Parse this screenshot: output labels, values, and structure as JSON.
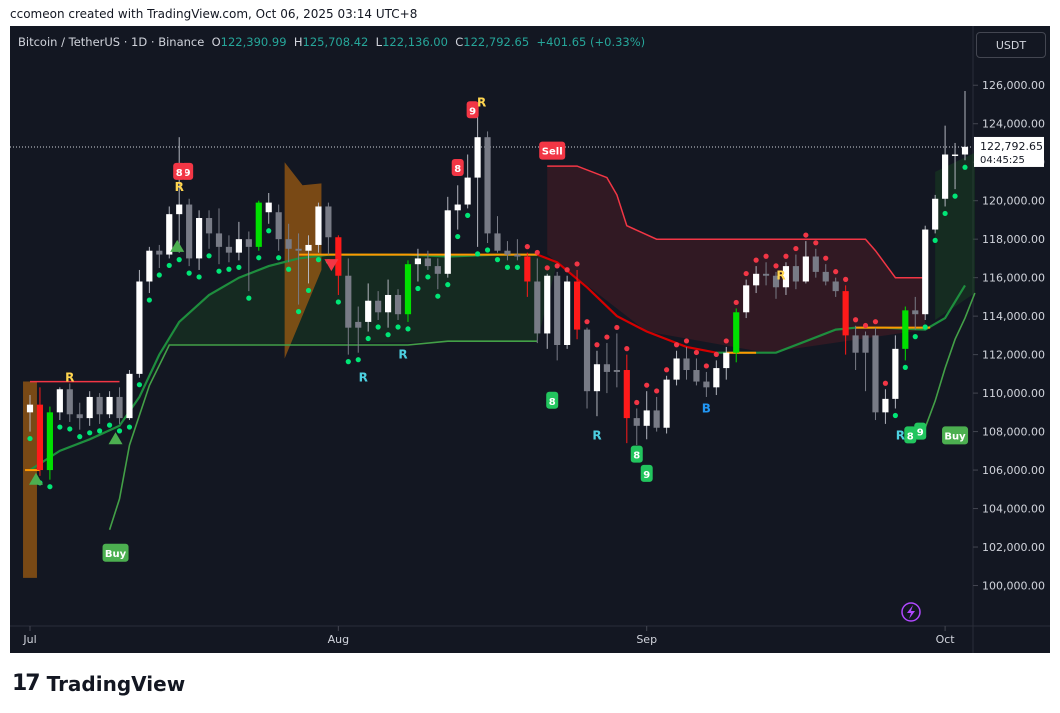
{
  "caption": "ccomeon created with TradingView.com, Oct 06, 2025 03:14 UTC+8",
  "legend": {
    "symbol": "Bitcoin / TetherUS · 1D · Binance",
    "open_key": "O",
    "open_val": "122,390.99",
    "high_key": "H",
    "high_val": "125,708.42",
    "low_key": "L",
    "low_val": "122,136.00",
    "close_key": "C",
    "close_val": "122,792.65",
    "change": "+401.65 (+0.33%)"
  },
  "currency_button": "USDT",
  "price_label": {
    "price": "122,792.65",
    "countdown": "04:45:25"
  },
  "footer": {
    "logo_mark": "17",
    "brand": "TradingView"
  },
  "colors": {
    "up": "#ffffff",
    "down": "#f23645",
    "bull": "#00c853",
    "bear": "#ff0000",
    "neutral": "#787b86",
    "bg": "#131722"
  },
  "chart_data": {
    "type": "candlestick",
    "y_range": [
      98000,
      127000
    ],
    "y_ticks": [
      100000,
      102000,
      104000,
      106000,
      108000,
      110000,
      112000,
      114000,
      116000,
      118000,
      120000,
      122000,
      124000,
      126000
    ],
    "y_tick_labels": [
      "100,000.00",
      "102,000.00",
      "104,000.00",
      "106,000.00",
      "108,000.00",
      "110,000.00",
      "112,000.00",
      "114,000.00",
      "116,000.00",
      "118,000.00",
      "120,000.00",
      "122,000.00",
      "124,000.00",
      "126,000.00"
    ],
    "x_labels": [
      {
        "label": "Jul",
        "idx": 0
      },
      {
        "label": "Aug",
        "idx": 31
      },
      {
        "label": "Sep",
        "idx": 62
      },
      {
        "label": "Oct",
        "idx": 92
      }
    ],
    "close_price": 122792.65,
    "candles": [
      [
        109000,
        109900,
        108000,
        109400,
        "w"
      ],
      [
        109400,
        110300,
        105700,
        106000,
        "r"
      ],
      [
        106000,
        109300,
        105500,
        109000,
        "g"
      ],
      [
        109000,
        110300,
        108600,
        110200,
        "w"
      ],
      [
        110200,
        110500,
        108500,
        108900,
        "n"
      ],
      [
        108900,
        109500,
        108100,
        108700,
        "n"
      ],
      [
        108700,
        110100,
        108300,
        109800,
        "w"
      ],
      [
        109800,
        110000,
        108400,
        108900,
        "n"
      ],
      [
        108900,
        110100,
        108700,
        109800,
        "w"
      ],
      [
        109800,
        110300,
        108400,
        108700,
        "n"
      ],
      [
        108700,
        111200,
        108600,
        111000,
        "w"
      ],
      [
        111000,
        116400,
        110800,
        115800,
        "w"
      ],
      [
        115800,
        117600,
        115200,
        117400,
        "w"
      ],
      [
        117400,
        117700,
        116500,
        117200,
        "n"
      ],
      [
        117200,
        119700,
        117000,
        119300,
        "w"
      ],
      [
        119300,
        123300,
        117300,
        119800,
        "w"
      ],
      [
        119800,
        120100,
        116600,
        117000,
        "n"
      ],
      [
        117000,
        119500,
        116400,
        119100,
        "w"
      ],
      [
        119100,
        119500,
        117500,
        118300,
        "n"
      ],
      [
        118300,
        119600,
        116700,
        117600,
        "n"
      ],
      [
        117600,
        118200,
        116800,
        117300,
        "n"
      ],
      [
        117300,
        118900,
        116900,
        118000,
        "w"
      ],
      [
        118000,
        118400,
        115300,
        117600,
        "n"
      ],
      [
        117600,
        120000,
        117400,
        119900,
        "g"
      ],
      [
        119900,
        120400,
        118800,
        119400,
        "w"
      ],
      [
        119400,
        119800,
        117400,
        118000,
        "n"
      ],
      [
        118000,
        118800,
        116800,
        117500,
        "n"
      ],
      [
        117500,
        118300,
        114600,
        117400,
        "n"
      ],
      [
        117400,
        118200,
        115700,
        117700,
        "w"
      ],
      [
        117700,
        119900,
        117300,
        119700,
        "w"
      ],
      [
        119700,
        119900,
        117200,
        118100,
        "n"
      ],
      [
        118100,
        118200,
        115100,
        116100,
        "r"
      ],
      [
        116100,
        117000,
        112000,
        113400,
        "n"
      ],
      [
        113400,
        114500,
        112100,
        113700,
        "n"
      ],
      [
        113700,
        115700,
        113200,
        114800,
        "w"
      ],
      [
        114800,
        115300,
        113800,
        114200,
        "n"
      ],
      [
        114200,
        115900,
        113400,
        115100,
        "w"
      ],
      [
        115100,
        115400,
        113800,
        114100,
        "n"
      ],
      [
        114100,
        116900,
        113700,
        116700,
        "g"
      ],
      [
        116700,
        117500,
        115800,
        117000,
        "w"
      ],
      [
        117000,
        117400,
        116400,
        116600,
        "n"
      ],
      [
        116600,
        117000,
        115400,
        116200,
        "n"
      ],
      [
        116200,
        120200,
        116000,
        119500,
        "w"
      ],
      [
        119500,
        120800,
        118500,
        119800,
        "w"
      ],
      [
        119800,
        122400,
        119600,
        121200,
        "w"
      ],
      [
        121200,
        124400,
        117600,
        123300,
        "w"
      ],
      [
        123300,
        123600,
        117800,
        118300,
        "n"
      ],
      [
        118300,
        119200,
        117300,
        117400,
        "n"
      ],
      [
        117400,
        117900,
        116900,
        117200,
        "n"
      ],
      [
        117200,
        118000,
        116900,
        117100,
        "n"
      ],
      [
        117100,
        117300,
        115000,
        115800,
        "r"
      ],
      [
        115800,
        117000,
        112600,
        113100,
        "n"
      ],
      [
        113100,
        116200,
        112300,
        116100,
        "w"
      ],
      [
        116100,
        116300,
        111700,
        112500,
        "n"
      ],
      [
        112500,
        116100,
        112300,
        115800,
        "w"
      ],
      [
        115800,
        116400,
        112800,
        113300,
        "r"
      ],
      [
        113300,
        113400,
        109200,
        110100,
        "n"
      ],
      [
        110100,
        112200,
        108800,
        111500,
        "w"
      ],
      [
        111500,
        112600,
        110000,
        111100,
        "n"
      ],
      [
        111100,
        113100,
        110300,
        111200,
        "n"
      ],
      [
        111200,
        112000,
        107400,
        108700,
        "r"
      ],
      [
        108700,
        109200,
        107300,
        108300,
        "n"
      ],
      [
        108300,
        110100,
        107600,
        109100,
        "w"
      ],
      [
        109100,
        109800,
        108000,
        108200,
        "n"
      ],
      [
        108200,
        110900,
        107900,
        110700,
        "w"
      ],
      [
        110700,
        112200,
        110400,
        111800,
        "w"
      ],
      [
        111800,
        112400,
        110700,
        111200,
        "n"
      ],
      [
        111200,
        111800,
        110400,
        110600,
        "n"
      ],
      [
        110600,
        111100,
        109800,
        110300,
        "n"
      ],
      [
        110300,
        111700,
        109900,
        111300,
        "w"
      ],
      [
        111300,
        112400,
        110700,
        112100,
        "w"
      ],
      [
        112100,
        114400,
        111600,
        114200,
        "g"
      ],
      [
        114200,
        115900,
        113900,
        115600,
        "w"
      ],
      [
        115600,
        116600,
        115200,
        116200,
        "w"
      ],
      [
        116200,
        116800,
        115600,
        116100,
        "n"
      ],
      [
        116100,
        116300,
        114900,
        115500,
        "n"
      ],
      [
        115500,
        116800,
        115100,
        116600,
        "w"
      ],
      [
        116600,
        117200,
        115400,
        115800,
        "n"
      ],
      [
        115800,
        117900,
        115700,
        117100,
        "w"
      ],
      [
        117100,
        117500,
        116000,
        116300,
        "n"
      ],
      [
        116300,
        116700,
        115600,
        115800,
        "n"
      ],
      [
        115800,
        116000,
        115000,
        115300,
        "n"
      ],
      [
        115300,
        115600,
        112000,
        113000,
        "r"
      ],
      [
        113000,
        113500,
        111200,
        112100,
        "n"
      ],
      [
        112100,
        113200,
        110100,
        113000,
        "n"
      ],
      [
        113000,
        113400,
        108600,
        109000,
        "n"
      ],
      [
        109000,
        110200,
        108400,
        109700,
        "w"
      ],
      [
        109700,
        113000,
        109200,
        112300,
        "w"
      ],
      [
        112300,
        114500,
        111700,
        114300,
        "g"
      ],
      [
        114300,
        115000,
        113300,
        114100,
        "n"
      ],
      [
        114100,
        118700,
        113800,
        118500,
        "w"
      ],
      [
        118500,
        120300,
        118300,
        120100,
        "w"
      ],
      [
        120100,
        123900,
        119700,
        122400,
        "w"
      ],
      [
        122400,
        123000,
        120600,
        122400,
        "w"
      ],
      [
        122400,
        125700,
        122100,
        122800,
        "w"
      ]
    ],
    "trend_fast": [
      [
        0,
        106000
      ],
      [
        3,
        107000
      ],
      [
        6,
        107600
      ],
      [
        9,
        108300
      ],
      [
        11,
        109800
      ],
      [
        13,
        112000
      ],
      [
        15,
        113700
      ],
      [
        18,
        115100
      ],
      [
        21,
        116000
      ],
      [
        24,
        116600
      ],
      [
        27,
        117000
      ],
      [
        30,
        117200
      ],
      [
        33,
        117200
      ],
      [
        38,
        117200
      ],
      [
        42,
        117100
      ],
      [
        47,
        117200
      ],
      [
        51,
        117200
      ],
      [
        53,
        116800
      ],
      [
        56,
        115500
      ],
      [
        59,
        114000
      ],
      [
        62,
        113200
      ],
      [
        66,
        112400
      ],
      [
        69,
        112100
      ],
      [
        72,
        112100
      ],
      [
        75,
        112100
      ],
      [
        78,
        112700
      ],
      [
        81,
        113300
      ],
      [
        83,
        113400
      ],
      [
        86,
        113400
      ],
      [
        90,
        113300
      ],
      [
        92,
        113900
      ],
      [
        94,
        115600
      ]
    ],
    "trend_slow": [
      [
        8,
        102900
      ],
      [
        9,
        104500
      ],
      [
        10,
        107300
      ],
      [
        12,
        110400
      ],
      [
        14,
        112500
      ],
      [
        15,
        112500
      ],
      [
        22,
        112500
      ],
      [
        30,
        112500
      ],
      [
        38,
        112500
      ],
      [
        42,
        112700
      ],
      [
        45,
        112700
      ],
      [
        51,
        112700
      ]
    ],
    "trend_slow_b": [
      [
        90,
        108200
      ],
      [
        91,
        109600
      ],
      [
        92,
        111300
      ],
      [
        93,
        112800
      ],
      [
        94,
        113900
      ],
      [
        95,
        115200
      ]
    ],
    "resistance": [
      [
        0,
        110600
      ],
      [
        8,
        110600
      ],
      [
        9,
        110600
      ]
    ],
    "sell_band": [
      [
        52,
        121800
      ],
      [
        55,
        121800
      ],
      [
        58,
        121200
      ],
      [
        59,
        120300
      ],
      [
        60,
        118700
      ],
      [
        63,
        118000
      ],
      [
        70,
        118000
      ],
      [
        78,
        118000
      ],
      [
        84,
        118000
      ],
      [
        85,
        117400
      ],
      [
        87,
        116000
      ],
      [
        90,
        116000
      ]
    ],
    "markers": [
      {
        "text": "R",
        "idx": 4,
        "price": 110800,
        "color": "#ffd54f"
      },
      {
        "text": "R",
        "idx": 15,
        "price": 120700,
        "color": "#ffd54f"
      },
      {
        "text": "9",
        "idx": 15.8,
        "price": 121500,
        "color": "#ffffff",
        "bg": "#f23645"
      },
      {
        "text": "8",
        "idx": 15,
        "price": 121500,
        "color": "#ffffff",
        "bg": "#f23645"
      },
      {
        "text": "9",
        "idx": 44.5,
        "price": 124700,
        "color": "#ffffff",
        "bg": "#f23645"
      },
      {
        "text": "R",
        "idx": 45.4,
        "price": 125100,
        "color": "#ffd54f"
      },
      {
        "text": "8",
        "idx": 43,
        "price": 121700,
        "color": "#ffffff",
        "bg": "#f23645"
      },
      {
        "text": "R",
        "idx": 33.5,
        "price": 110800,
        "color": "#4dd0e1"
      },
      {
        "text": "R",
        "idx": 37.5,
        "price": 112000,
        "color": "#4dd0e1"
      },
      {
        "text": "8",
        "idx": 52.5,
        "price": 109600,
        "color": "#ffffff",
        "bg": "#22c55e"
      },
      {
        "text": "R",
        "idx": 57,
        "price": 107800,
        "color": "#4dd0e1"
      },
      {
        "text": "8",
        "idx": 61,
        "price": 106800,
        "color": "#ffffff",
        "bg": "#22c55e"
      },
      {
        "text": "9",
        "idx": 62,
        "price": 105800,
        "color": "#ffffff",
        "bg": "#22c55e"
      },
      {
        "text": "B",
        "idx": 68,
        "price": 109200,
        "color": "#2196f3"
      },
      {
        "text": "R",
        "idx": 75.5,
        "price": 116100,
        "color": "#ffd54f"
      },
      {
        "text": "R",
        "idx": 87.5,
        "price": 107800,
        "color": "#4dd0e1"
      },
      {
        "text": "8",
        "idx": 88.5,
        "price": 107800,
        "color": "#ffffff",
        "bg": "#22c55e"
      },
      {
        "text": "9",
        "idx": 89.5,
        "price": 108000,
        "color": "#ffffff",
        "bg": "#22c55e"
      }
    ],
    "labels": [
      {
        "text": "Buy",
        "idx": 8.6,
        "price": 101700,
        "bg": "#4caf50"
      },
      {
        "text": "Sell",
        "idx": 52.5,
        "price": 122600,
        "bg": "#f23645"
      },
      {
        "text": "Buy",
        "idx": 93,
        "price": 107800,
        "bg": "#4caf50"
      }
    ]
  }
}
